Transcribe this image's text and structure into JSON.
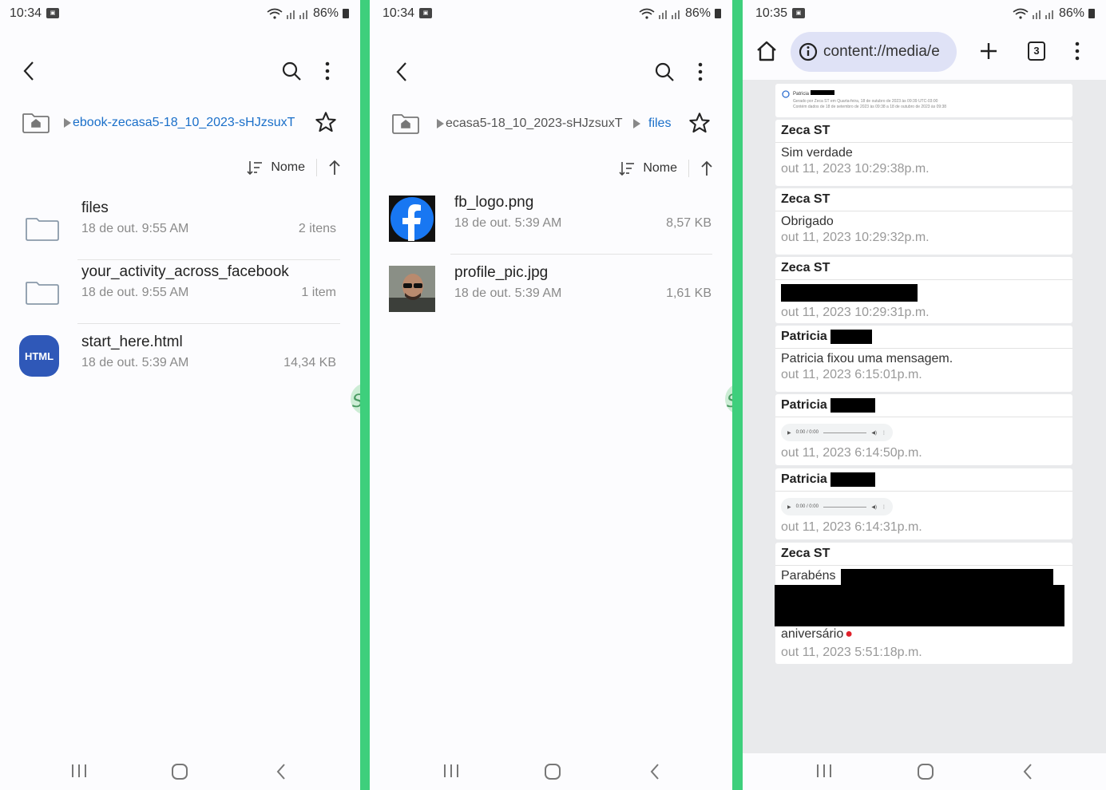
{
  "status1": {
    "time": "10:34",
    "battery": "86%"
  },
  "status2": {
    "time": "10:34",
    "battery": "86%"
  },
  "status3": {
    "time": "10:35",
    "battery": "86%"
  },
  "panel1": {
    "crumb_current": "ebook-zecasa5-18_10_2023-sHJzsuxT",
    "sort_label": "Nome",
    "items": [
      {
        "name": "files",
        "meta": "18 de out. 9:55 AM",
        "size": "2 itens"
      },
      {
        "name": "your_activity_across_facebook",
        "meta": "18 de out. 9:55 AM",
        "size": "1 item"
      },
      {
        "name": "start_here.html",
        "meta": "18 de out. 5:39 AM",
        "size": "14,34 KB",
        "badge": "HTML"
      }
    ]
  },
  "panel2": {
    "crumb_parent": "ecasa5-18_10_2023-sHJzsuxT",
    "crumb_current": "files",
    "sort_label": "Nome",
    "items": [
      {
        "name": "fb_logo.png",
        "meta": "18 de out. 5:39 AM",
        "size": "8,57 KB"
      },
      {
        "name": "profile_pic.jpg",
        "meta": "18 de out. 5:39 AM",
        "size": "1,61 KB"
      }
    ]
  },
  "browser": {
    "url": "content://media/e",
    "tab_count": "3",
    "header_name": "Patricia",
    "header_sub1": "Gerado por Zeca ST em Quarta-feira, 18 de outubro de 2023 às 09:39 UTC-03:00",
    "header_sub2": "Contém dados de 18 de setembro de 2023 às 09:38 a 18 de outubro de 2023 às 09:38",
    "messages": [
      {
        "sender": "Zeca ST",
        "text": "Sim verdade",
        "ts": "out 11, 2023 10:29:38p.m."
      },
      {
        "sender": "Zeca ST",
        "text": "Obrigado",
        "ts": "out 11, 2023 10:29:32p.m."
      },
      {
        "sender": "Zeca ST",
        "text": "",
        "ts": "out 11, 2023 10:29:31p.m."
      },
      {
        "sender": "Patricia",
        "text": "Patricia fixou uma mensagem.",
        "ts": "out 11, 2023 6:15:01p.m."
      },
      {
        "sender": "Patricia",
        "audio": "0:00 / 0:00",
        "ts": "out 11, 2023 6:14:50p.m."
      },
      {
        "sender": "Patricia",
        "audio": "0:00 / 0:00",
        "ts": "out 11, 2023 6:14:31p.m."
      },
      {
        "sender": "Zeca ST",
        "text": "Parabéns",
        "text_end": "aniversário",
        "ts": "out 11, 2023 5:51:18p.m."
      }
    ]
  },
  "colors": {
    "accent": "#1a6fc9",
    "html_badge": "#2f58b8",
    "divider": "#3ecf7c",
    "fb_blue": "#1877f2"
  }
}
